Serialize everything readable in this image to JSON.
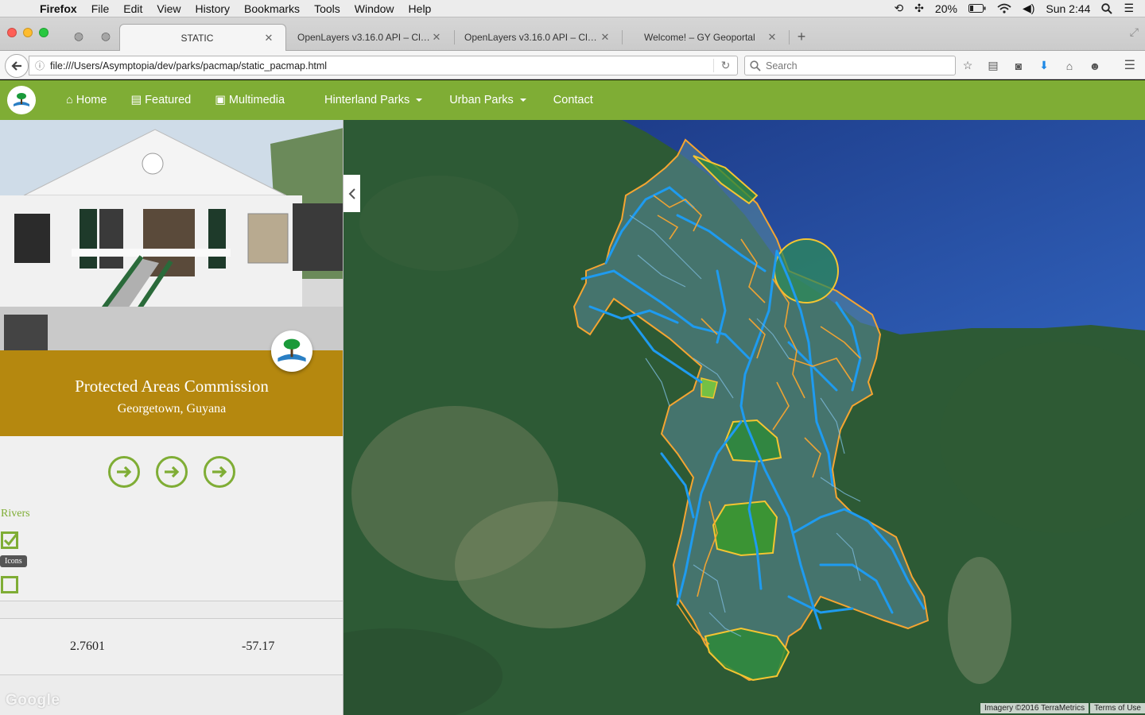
{
  "menubar": {
    "app": "Firefox",
    "items": [
      "File",
      "Edit",
      "View",
      "History",
      "Bookmarks",
      "Tools",
      "Window",
      "Help"
    ],
    "battery": "20%",
    "clock": "Sun 2:44"
  },
  "tabs": [
    {
      "title": "STATIC"
    },
    {
      "title": "OpenLayers v3.16.0 API – Clas..."
    },
    {
      "title": "OpenLayers v3.16.0 API – Clas..."
    },
    {
      "title": "Welcome! – GY Geoportal"
    }
  ],
  "navbar": {
    "url": "file:///Users/Asymptopia/dev/parks/pacmap/static_pacmap.html",
    "search_placeholder": "Search"
  },
  "site_nav": {
    "home": "Home",
    "featured": "Featured",
    "multimedia": "Multimedia",
    "hinterland": "Hinterland Parks",
    "urban": "Urban Parks",
    "contact": "Contact"
  },
  "sidebar": {
    "title": "Protected Areas Commission",
    "subtitle": "Georgetown, Guyana",
    "layer_label": "Rivers",
    "tooltip": "Icons",
    "rivers_checked": true,
    "icons_checked": false,
    "lat": "2.7601",
    "lon": "-57.17",
    "google_logo": "Google"
  },
  "map": {
    "attribution": "Imagery ©2016 TerraMetrics",
    "terms": "Terms of Use"
  },
  "colors": {
    "brand_green": "#7fad35",
    "banner_gold": "#b5880f",
    "river_blue": "#1e9bf0",
    "road_orange": "#f5a531"
  }
}
